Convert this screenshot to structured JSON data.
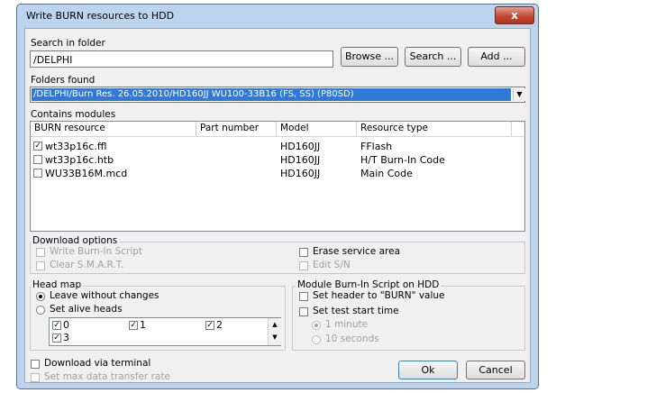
{
  "window": {
    "title": "Write BURN resources to HDD",
    "close_glyph": "x"
  },
  "search": {
    "label": "Search in folder",
    "value": "/DELPHI",
    "browse": "Browse ...",
    "search": "Search ...",
    "add": "Add ..."
  },
  "folders": {
    "label": "Folders found",
    "selected": "/DELPHI/Burn Res. 26.05.2010/HD160JJ WU100-33B16 (FS, SS) (P80SD)"
  },
  "modules": {
    "label": "Contains modules",
    "columns": [
      "BURN resource",
      "Part number",
      "Model",
      "Resource type"
    ],
    "rows": [
      {
        "checked": true,
        "resource": "wt33p16c.ffl",
        "part": "",
        "model": "HD160JJ",
        "type": "FFlash"
      },
      {
        "checked": false,
        "resource": "wt33p16c.htb",
        "part": "",
        "model": "HD160JJ",
        "type": "H/T Burn-In Code"
      },
      {
        "checked": false,
        "resource": "WU33B16M.mcd",
        "part": "",
        "model": "HD160JJ",
        "type": "Main Code"
      }
    ]
  },
  "download_options": {
    "label": "Download options",
    "write_burnin": "Write Burn-In Script",
    "clear_smart": "Clear S.M.A.R.T.",
    "erase_service": "Erase service area",
    "edit_sn": "Edit S/N"
  },
  "head_map": {
    "label": "Head map",
    "leave": "Leave without changes",
    "set_alive": "Set alive heads",
    "heads": [
      "0",
      "1",
      "2",
      "3"
    ]
  },
  "module_script": {
    "label": "Module Burn-In Script on HDD",
    "set_header": "Set header to \"BURN\" value",
    "set_test_start": "Set test start time",
    "one_minute": "1 minute",
    "ten_seconds": "10 seconds"
  },
  "download_terminal": "Download via terminal",
  "max_rate": "Set max data transfer rate",
  "ok": "Ok",
  "cancel": "Cancel"
}
